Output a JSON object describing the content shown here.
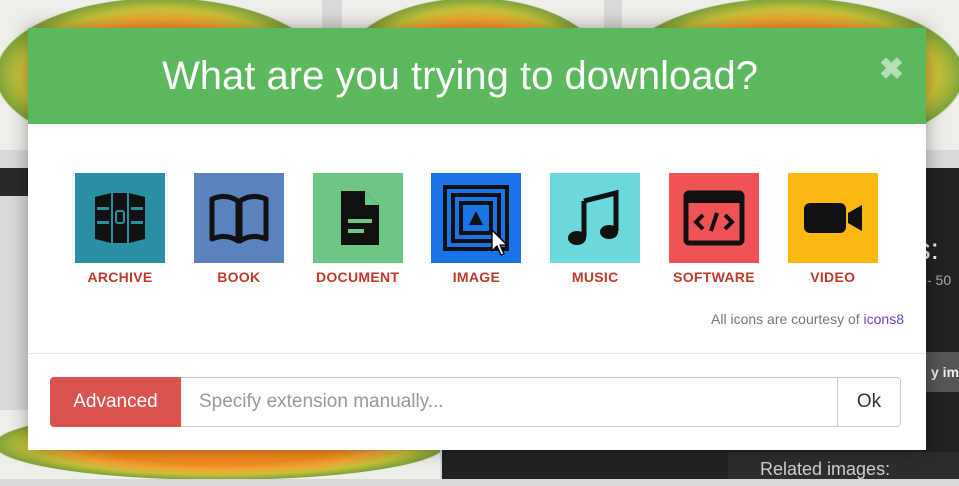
{
  "modal": {
    "title": "What are you trying to download?",
    "close_symbol": "✖",
    "categories": [
      {
        "label": "ARCHIVE",
        "icon": "archive-icon",
        "color": "#2a8fa3"
      },
      {
        "label": "BOOK",
        "icon": "book-icon",
        "color": "#5a82bf"
      },
      {
        "label": "DOCUMENT",
        "icon": "document-icon",
        "color": "#6dc782"
      },
      {
        "label": "IMAGE",
        "icon": "image-icon",
        "color": "#1a73e8"
      },
      {
        "label": "MUSIC",
        "icon": "music-icon",
        "color": "#6ad8dc"
      },
      {
        "label": "SOFTWARE",
        "icon": "software-icon",
        "color": "#ef5356"
      },
      {
        "label": "VIDEO",
        "icon": "video-icon",
        "color": "#fbb712"
      }
    ],
    "credit_text": "All icons are courtesy of",
    "credit_link": "icons8",
    "advanced_label": "Advanced",
    "extension_placeholder": "Specify extension manually...",
    "ok_label": "Ok"
  },
  "background": {
    "title_fragment": "as:",
    "subtitle_fragment": "- 50",
    "button_fragment": "y ima",
    "related_images": "Related images:"
  },
  "colors": {
    "header_green": "#5cb85c",
    "advanced_red": "#d9534f",
    "label_red": "#c0392b",
    "link_purple": "#6f42c1"
  }
}
